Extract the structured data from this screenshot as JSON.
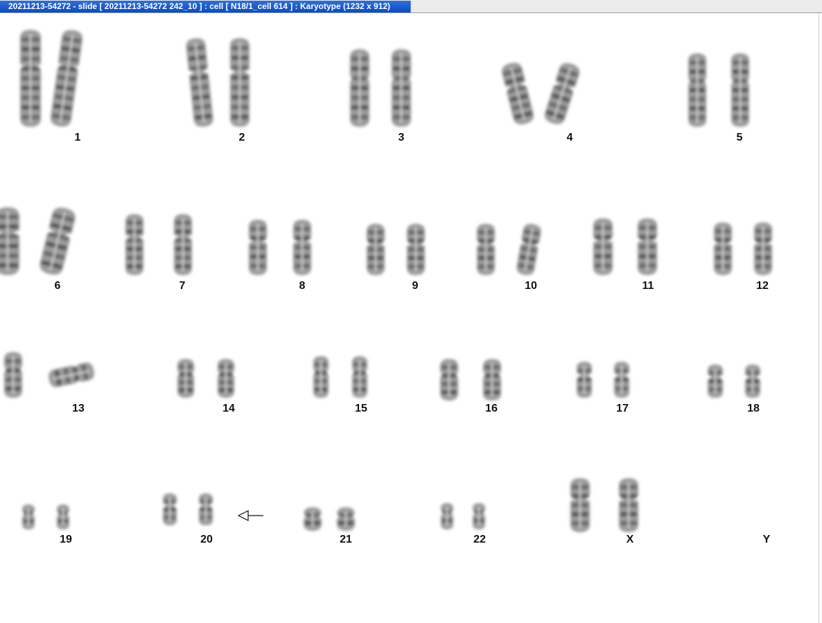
{
  "window": {
    "title": "20211213-54272 - slide [ 20211213-54272 242_10 ] : cell [ N18/1_cell 614 ] : Karyotype  (1232 x 912)"
  },
  "karyotype": {
    "labels": {
      "c1": "1",
      "c2": "2",
      "c3": "3",
      "c4": "4",
      "c5": "5",
      "c6": "6",
      "c7": "7",
      "c8": "8",
      "c9": "9",
      "c10": "10",
      "c11": "11",
      "c12": "12",
      "c13": "13",
      "c14": "14",
      "c15": "15",
      "c16": "16",
      "c17": "17",
      "c18": "18",
      "c19": "19",
      "c20": "20",
      "c21": "21",
      "c22": "22",
      "cX": "X",
      "cY": "Y"
    },
    "annotation": "arrow pointing at chromosome 20"
  }
}
